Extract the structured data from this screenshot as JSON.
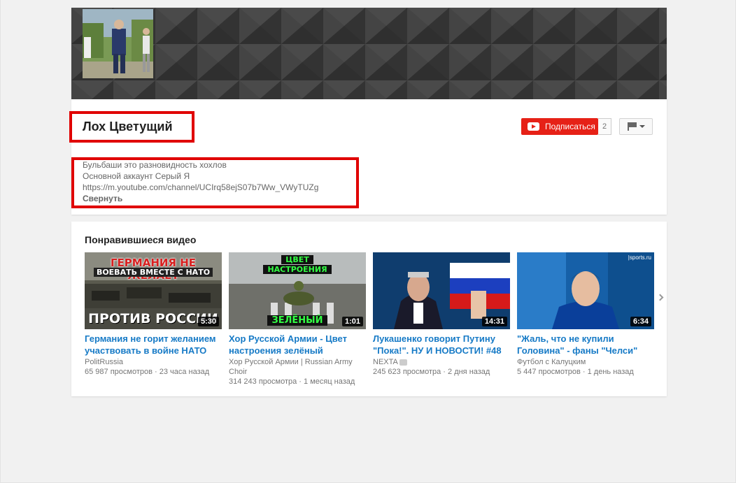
{
  "channel": {
    "name": "Лох Цветущий",
    "subscribe_label": "Подписаться",
    "subscriber_count": "2",
    "description": {
      "line1": "Бульбаши это разновидность хохлов",
      "line2": "Основной аккаунт Серый Я",
      "link": "https://m.youtube.com/channel/UCIrq58ejS07b7Ww_VWyTUZg",
      "collapse_label": "Свернуть"
    }
  },
  "liked": {
    "title": "Понравившиеся видео",
    "videos": [
      {
        "title": "Германия не горит желанием участвовать в войне НАТО",
        "channel": "PolitRussia",
        "views": "65 987 просмотров",
        "age": "23 часа назад",
        "duration": "5:30",
        "thumb_top": "ГЕРМАНИЯ НЕ ЖЕЛАЕТ",
        "thumb_mid": "ВОЕВАТЬ ВМЕСТЕ С НАТО",
        "thumb_bottom": "ПРОТИВ РОССИИ"
      },
      {
        "title": "Хор Русской Армии - Цвет настроения зелёный",
        "channel": "Хор Русской Армии | Russian Army Choir",
        "views": "314 243 просмотра",
        "age": "1 месяц назад",
        "duration": "1:01",
        "thumb_top": "ЦВЕТ",
        "thumb_mid": "НАСТРОЕНИЯ",
        "thumb_bottom": "ЗЕЛЁНЫЙ"
      },
      {
        "title": "Лукашенко говорит Путину \"Пока!\". НУ И НОВОСТИ! #48",
        "channel": "NEXTA",
        "views": "245 623 просмотра",
        "age": "2 дня назад",
        "duration": "14:31"
      },
      {
        "title": "\"Жаль, что не купили Головина\" - фаны \"Челси\"",
        "channel": "Футбол с Калуцким",
        "views": "5 447 просмотров",
        "age": "1 день назад",
        "duration": "6:34",
        "thumb_badge": "|sports.ru"
      }
    ]
  },
  "icons": {
    "subscribe": "youtube-play-icon",
    "flag": "flag-icon",
    "next": "chevron-right-icon"
  },
  "colors": {
    "subscribe_bg": "#e62117",
    "link": "#167ac6",
    "highlight_box": "#e00000"
  }
}
